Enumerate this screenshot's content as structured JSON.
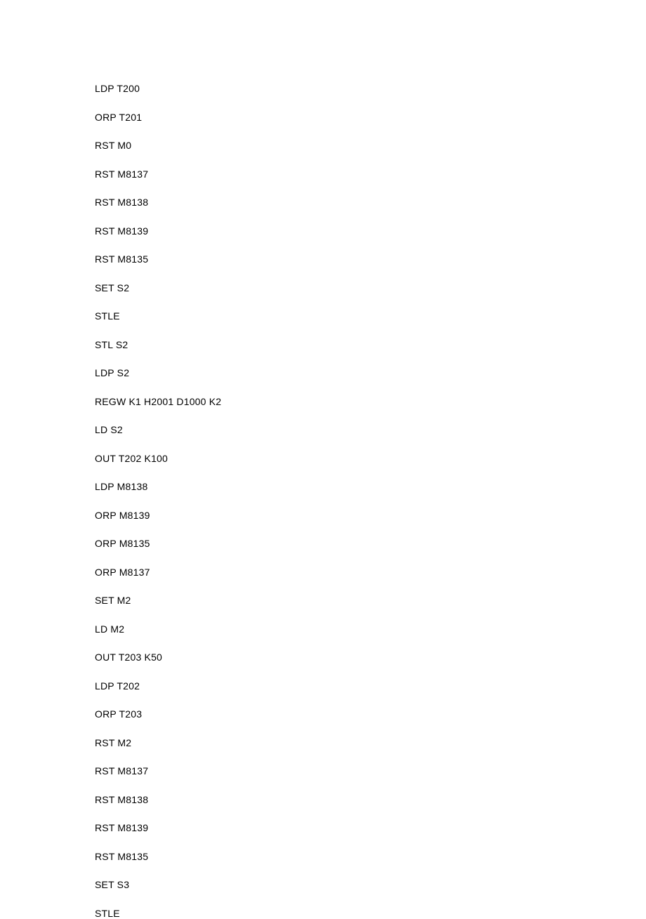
{
  "lines": [
    "LDP T200",
    "ORP T201",
    "RST M0",
    "RST M8137",
    "RST M8138",
    "RST M8139",
    "RST M8135",
    "SET S2",
    "STLE",
    "STL S2",
    "LDP S2",
    "REGW K1 H2001 D1000 K2",
    "LD S2",
    "OUT T202 K100",
    "LDP M8138",
    "ORP M8139",
    "ORP M8135",
    "ORP M8137",
    "SET M2",
    "LD M2",
    "OUT T203 K50",
    "LDP T202",
    "ORP T203",
    "RST M2",
    "RST M8137",
    "RST M8138",
    "RST M8139",
    "RST M8135",
    "SET S3",
    "STLE"
  ]
}
